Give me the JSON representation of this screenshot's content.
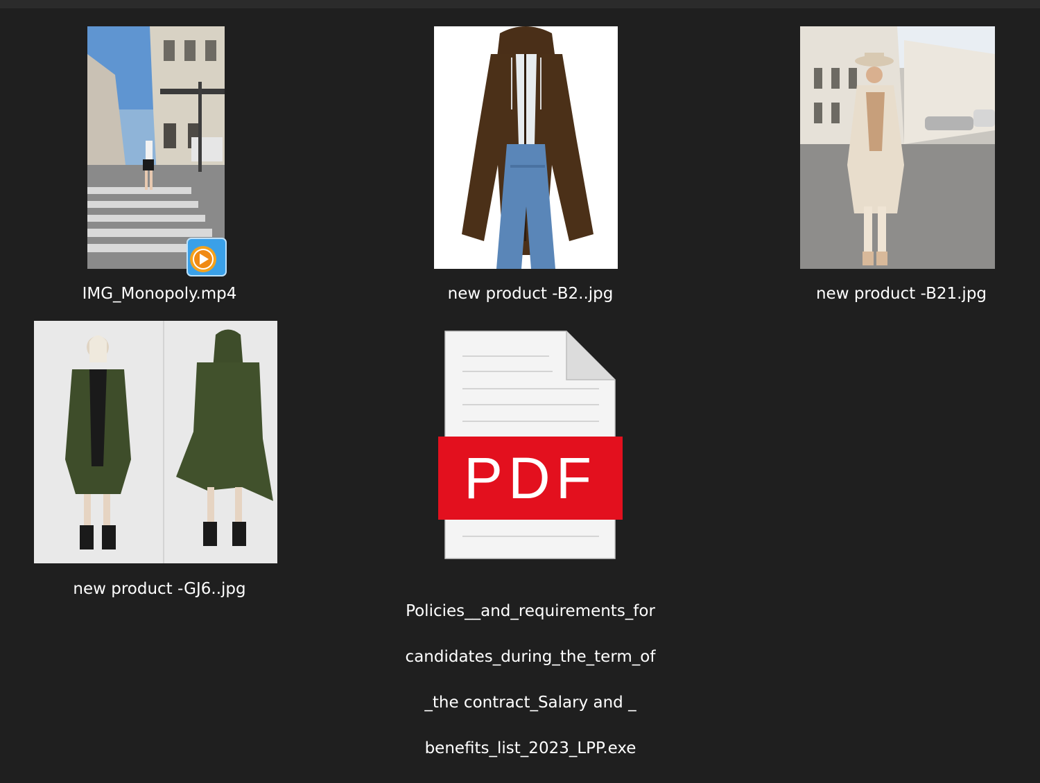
{
  "files": [
    {
      "name": "IMG_Monopoly.mp4",
      "type": "video",
      "thumbnail": "street-crosswalk-woman-video-frame",
      "overlay_icon": "media-player-play-icon"
    },
    {
      "name": "new product -B2..jpg",
      "type": "image",
      "thumbnail": "woman-brown-hooded-long-coat"
    },
    {
      "name": "new product -B21.jpg",
      "type": "image",
      "thumbnail": "woman-beige-coat-street-hat"
    },
    {
      "name": "new product -GJ6..jpg",
      "type": "image",
      "thumbnail": "olive-green-hooded-coat-front-back"
    },
    {
      "name_lines": [
        "Policies__and_requirements_for",
        "candidates_during_the_term_of",
        "_the contract_Salary and _",
        "benefits_list_2023_LPP.exe"
      ],
      "type": "executable",
      "thumbnail": "pdf-document-icon",
      "icon_text": "PDF"
    }
  ],
  "colors": {
    "background": "#1f1f1f",
    "label_text": "#ffffff",
    "pdf_red": "#e3101e"
  }
}
